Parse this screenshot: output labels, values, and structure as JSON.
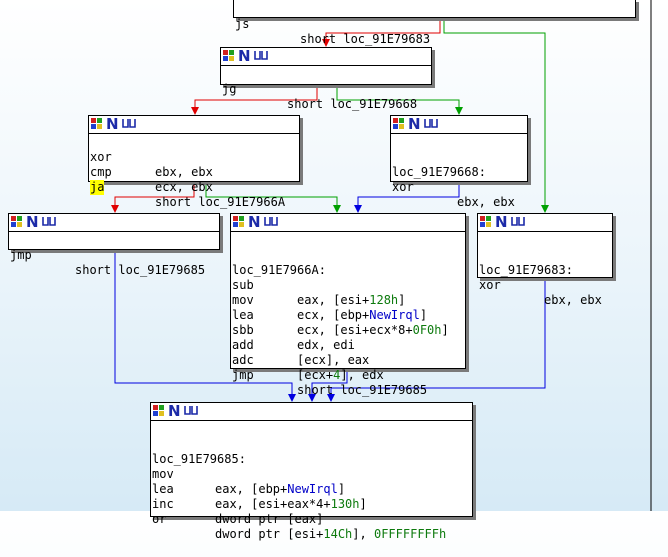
{
  "colors": {
    "edge_true": "#00a000",
    "edge_false": "#e00000",
    "edge_uncond": "#0000e0",
    "header_n": "#1c2aa8",
    "number": "#0d7a0d",
    "symbol": "#0000c8",
    "highlight": "#ffff00"
  },
  "header": {
    "n_glyph": "N",
    "icon_names": [
      "graph-node-icon",
      "name-icon",
      "xrefs-icon"
    ]
  },
  "nodes": {
    "top": {
      "lines": [
        {
          "mn": "js",
          "op": "short loc_91E79683"
        }
      ]
    },
    "jg_node": {
      "lines": [
        {
          "mn": "jg",
          "op": "short loc_91E79668"
        }
      ]
    },
    "xor_cmp_node": {
      "lines": [
        {
          "mn": "xor",
          "op": "ebx, ebx"
        },
        {
          "mn": "cmp",
          "op": "ecx, ebx"
        },
        {
          "mn": "ja",
          "op": "short loc_91E7966A"
        }
      ]
    },
    "loc_668_node": {
      "label": "loc_91E79668:",
      "lines": [
        {
          "mn": "xor",
          "op": "ebx, ebx"
        }
      ]
    },
    "jmp_node": {
      "lines": [
        {
          "mn": "jmp",
          "op": "short loc_91E79685"
        }
      ]
    },
    "loc_66a_node": {
      "label": "loc_91E7966A:",
      "lines": [
        {
          "mn": "sub",
          "op": "eax, [esi+128h]"
        },
        {
          "mn": "mov",
          "op": "ecx, [ebp+NewIrql]"
        },
        {
          "mn": "lea",
          "op": "ecx, [esi+ecx*8+0F0h]"
        },
        {
          "mn": "sbb",
          "op": "edx, edi"
        },
        {
          "mn": "add",
          "op": "[ecx], eax"
        },
        {
          "mn": "adc",
          "op": "[ecx+4], edx"
        },
        {
          "mn": "jmp",
          "op": "short loc_91E79685"
        }
      ]
    },
    "loc_683_node": {
      "label": "loc_91E79683:",
      "lines": [
        {
          "mn": "xor",
          "op": "ebx, ebx"
        }
      ]
    },
    "loc_685_node": {
      "label": "loc_91E79685:",
      "lines": [
        {
          "mn": "mov",
          "op": "eax, [ebp+NewIrql]"
        },
        {
          "mn": "lea",
          "op": "eax, [esi+eax*4+130h]"
        },
        {
          "mn": "inc",
          "op": "dword ptr [eax]"
        },
        {
          "mn": "or",
          "op": "dword ptr [esi+14Ch], 0FFFFFFFFh"
        }
      ]
    }
  }
}
